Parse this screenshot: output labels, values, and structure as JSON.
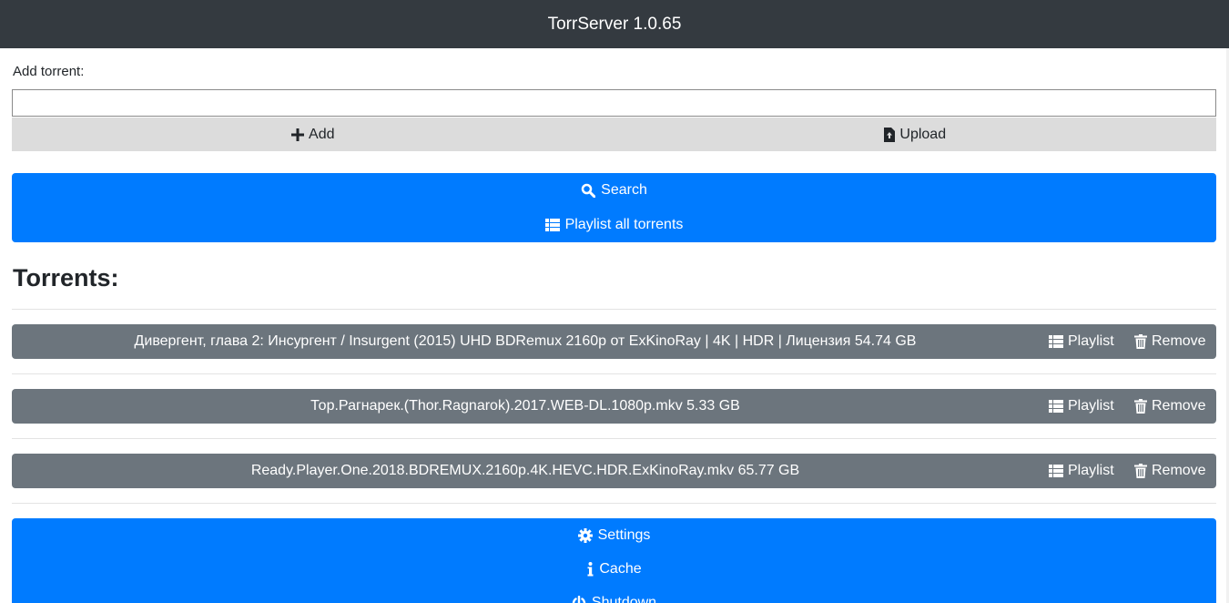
{
  "header": {
    "title": "TorrServer 1.0.65"
  },
  "add_torrent": {
    "label": "Add torrent:",
    "input_value": "",
    "add_label": "Add",
    "upload_label": "Upload"
  },
  "actions": {
    "search_label": "Search",
    "playlist_all_label": "Playlist all torrents"
  },
  "torrents": {
    "heading": "Torrents:",
    "playlist_label": "Playlist",
    "remove_label": "Remove",
    "items": [
      {
        "name": "Дивергент, глава 2: Инсургент / Insurgent (2015) UHD BDRemux 2160p от ExKinoRay | 4K | HDR | Лицензия 54.74 GB"
      },
      {
        "name": "Тор.Рагнарек.(Thor.Ragnarok).2017.WEB-DL.1080p.mkv 5.33 GB"
      },
      {
        "name": "Ready.Player.One.2018.BDREMUX.2160p.4K.HEVC.HDR.ExKinoRay.mkv 65.77 GB"
      }
    ]
  },
  "footer_menu": {
    "settings_label": "Settings",
    "cache_label": "Cache",
    "shutdown_label": "Shutdown"
  },
  "colors": {
    "navbar": "#343a40",
    "primary": "#007bff",
    "secondary": "#6c757d",
    "light_button": "#dcdcdc"
  }
}
